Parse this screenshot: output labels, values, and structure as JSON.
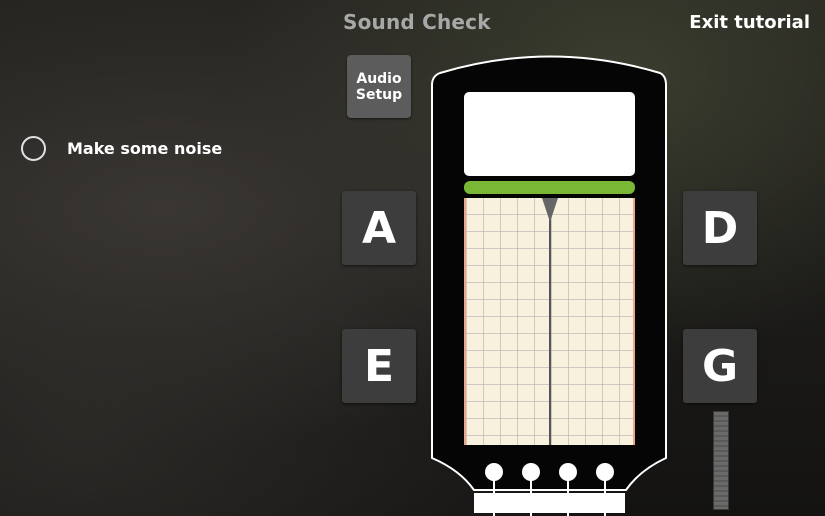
{
  "header": {
    "title": "Sound Check",
    "exit_label": "Exit tutorial"
  },
  "status": {
    "noise_label": "Make some noise"
  },
  "controls": {
    "audio_setup_label": "Audio\nSetup"
  },
  "strings": {
    "A": "A",
    "D": "D",
    "E": "E",
    "G": "G"
  },
  "icons": {
    "noise_indicator": "circle-outline-icon",
    "needle": "tuner-needle-icon",
    "tuning_pegs": "tuning-peg-icon"
  },
  "colors": {
    "in_tune_bar": "#7ab734",
    "grid_background": "#f7f1dd",
    "button_bg": "#3d3d3d",
    "audio_button_bg": "#5c5c5c"
  }
}
